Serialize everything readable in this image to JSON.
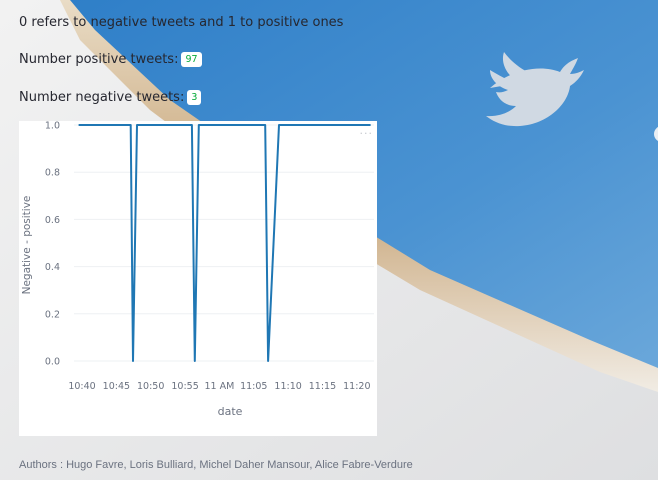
{
  "intro_text": "0 refers to negative tweets and 1 to positive ones",
  "positive": {
    "label": "Number positive tweets:",
    "count": "97"
  },
  "negative": {
    "label": "Number negative tweets:",
    "count": "3"
  },
  "chart_menu_icon": "ellipsis-icon",
  "chart_data": {
    "type": "line",
    "title": "",
    "xlabel": "date",
    "ylabel": "Negative - positive",
    "ylim": [
      0,
      1
    ],
    "y_ticks": [
      "0.0",
      "0.2",
      "0.4",
      "0.6",
      "0.8",
      "1.0"
    ],
    "x_ticks": [
      "10:40",
      "10:45",
      "10:50",
      "10:55",
      "11 AM",
      "11:05",
      "11:10",
      "11:15",
      "11:20"
    ],
    "line_color": "#1f77b4",
    "grid": true,
    "series": [
      {
        "points": [
          [
            "10:39:30",
            1
          ],
          [
            "10:47:05",
            1
          ],
          [
            "10:47:25",
            0
          ],
          [
            "10:48:00",
            1
          ],
          [
            "10:56:00",
            1
          ],
          [
            "10:56:25",
            0
          ],
          [
            "10:57:00",
            1
          ],
          [
            "11:06:40",
            1
          ],
          [
            "11:07:05",
            0
          ],
          [
            "11:08:40",
            1
          ],
          [
            "11:22:00",
            1
          ]
        ]
      }
    ]
  },
  "footer": "Authors : Hugo Favre, Loris Bulliard, Michel Daher Mansour, Alice Fabre-Verdure"
}
